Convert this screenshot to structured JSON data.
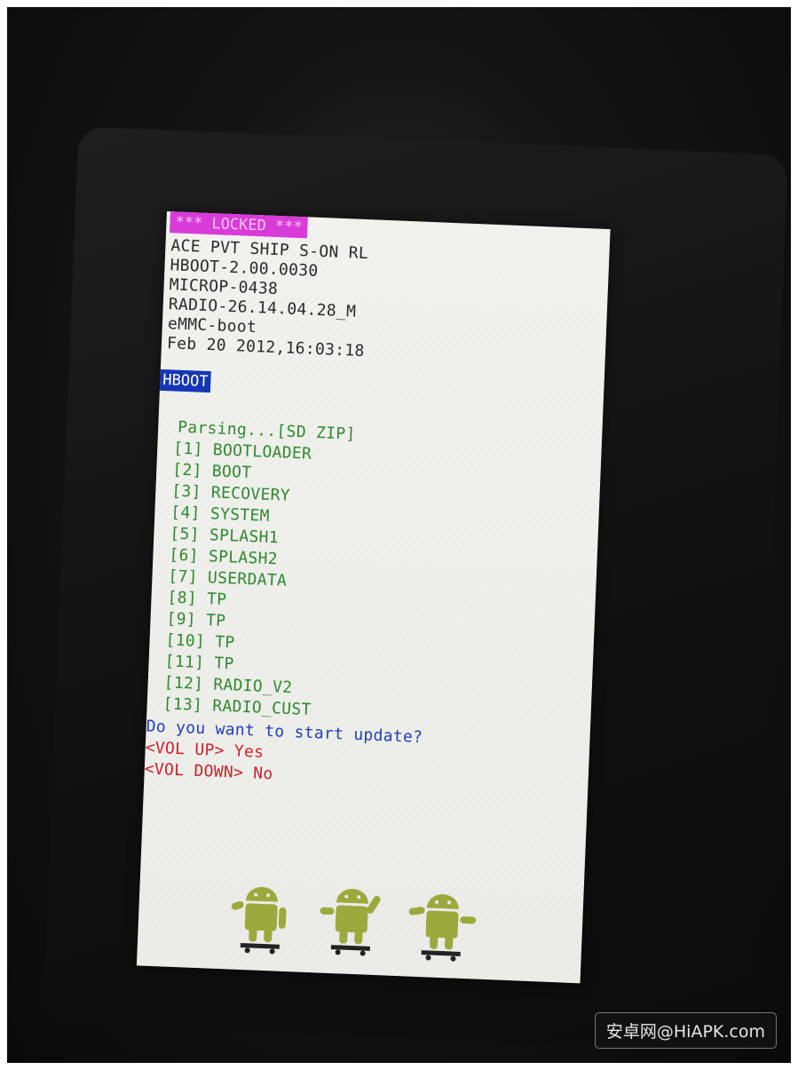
{
  "screen": {
    "header": {
      "locked_label": "*** LOCKED ***",
      "lines": [
        "ACE PVT SHIP S-ON RL",
        "HBOOT-2.00.0030",
        "MICROP-0438",
        "RADIO-26.14.04.28_M",
        "eMMC-boot",
        "Feb 20 2012,16:03:18"
      ]
    },
    "mode_label": "HBOOT",
    "parsing_label": "Parsing...[SD ZIP]",
    "items": [
      "[1] BOOTLOADER",
      "[2] BOOT",
      "[3] RECOVERY",
      "[4] SYSTEM",
      "[5] SPLASH1",
      "[6] SPLASH2",
      "[7] USERDATA",
      "[8] TP",
      "[9] TP",
      "[10] TP",
      "[11] TP",
      "[12] RADIO_V2",
      "[13] RADIO_CUST"
    ],
    "prompt": "Do you want to start update?",
    "vol_up_option": "<VOL UP> Yes",
    "vol_down_option": "<VOL DOWN> No"
  },
  "colors": {
    "locked_bg": "#d83bd8",
    "mode_bg": "#1537b5",
    "item_text": "#2f8a2f",
    "prompt_text": "#2040b8",
    "option_text": "#c8242a",
    "android_green": "#9aaa3c"
  },
  "icons": [
    "android-skateboard-icon"
  ],
  "watermark": "安卓网@HiAPK.com"
}
